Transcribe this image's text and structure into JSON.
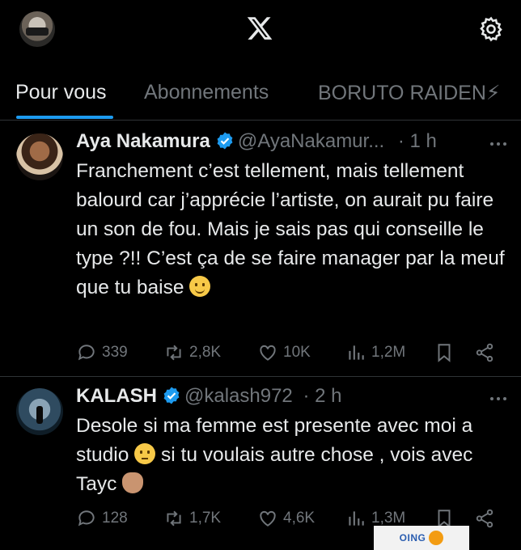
{
  "header": {
    "logo": "x-logo",
    "settings_icon": "gear-icon"
  },
  "tabs": [
    {
      "label": "Pour vous",
      "active": true
    },
    {
      "label": "Abonnements",
      "active": false
    },
    {
      "label": "BORUTO RAIDEN⚡",
      "active": false
    }
  ],
  "tweets": [
    {
      "name": "Aya Nakamura",
      "handle": "@AyaNakamur...",
      "time": "· 1 h",
      "verified": true,
      "text": "Franchement c’est tellement, mais tellement balourd car j’apprécie l’artiste, on aurait pu faire un son de fou. Mais je sais pas qui conseille le type ?!! C’est ça de se faire manager par la meuf que tu baise",
      "emoji": "slightly-smiling-face",
      "stats": {
        "replies": "339",
        "reposts": "2,8K",
        "likes": "10K",
        "views": "1,2M"
      }
    },
    {
      "name": "KALASH",
      "handle": "@kalash972",
      "time": "· 2 h",
      "verified": true,
      "text_before_emoji": "Desole si ma femme est presente avec moi a studio",
      "text_after_emoji": "si tu voulais autre chose , vois avec Tayc",
      "emoji_1": "pensive-face",
      "emoji_2": "waving-hand",
      "stats": {
        "replies": "128",
        "reposts": "1,7K",
        "likes": "4,6K",
        "views": "1,3M"
      }
    }
  ],
  "watermark": {
    "text": "OING"
  },
  "colors": {
    "background": "#000000",
    "text": "#e7e9ea",
    "muted": "#71767b",
    "accent": "#1d9bf0",
    "divider": "#2f3336"
  }
}
